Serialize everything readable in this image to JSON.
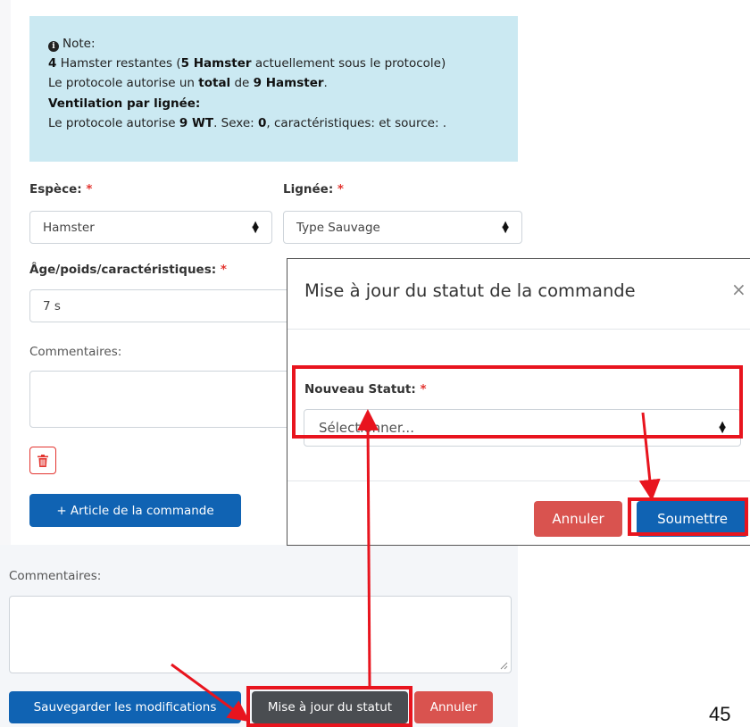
{
  "note": {
    "title": "Note:",
    "line1": {
      "count": "4",
      "t1": " Hamster restantes (",
      "bold1": "5 Hamster",
      "t2": " actuellement sous le protocole)"
    },
    "line2": {
      "t1": "Le protocole autorise un ",
      "bold1": "total",
      "t2": " de ",
      "bold2": "9 Hamster",
      "t3": "."
    },
    "line3": "Ventilation par lignée:",
    "line4": {
      "t1": "Le protocole autorise ",
      "bold1": "9 WT",
      "t2": ". Sexe: ",
      "bold2": "0",
      "t3": ", caractéristiques: et source: ."
    }
  },
  "form": {
    "espece_label": "Espèce:",
    "espece_value": "Hamster",
    "lignee_label": "Lignée:",
    "lignee_value": "Type Sauvage",
    "age_label": "Âge/poids/caractéristiques:",
    "age_value": "7 s",
    "commentaires_label": "Commentaires:",
    "required_mark": "*",
    "add_item_button": "+ Article de la commande",
    "bottom_commentaires_label": "Commentaires:"
  },
  "footer": {
    "save_button": "Sauvegarder les modifications",
    "status_button": "Mise à jour du statut",
    "cancel_button": "Annuler"
  },
  "modal": {
    "title": "Mise à jour du statut de la commande",
    "close": "×",
    "new_status_label": "Nouveau Statut:",
    "select_placeholder": "Sélectionner...",
    "cancel_button": "Annuler",
    "submit_button": "Soumettre"
  },
  "page_number": "45",
  "colors": {
    "annotation_red": "#e8141e",
    "primary_blue": "#1063b3",
    "danger_red": "#d9534f",
    "note_bg": "#cbe9f2"
  }
}
